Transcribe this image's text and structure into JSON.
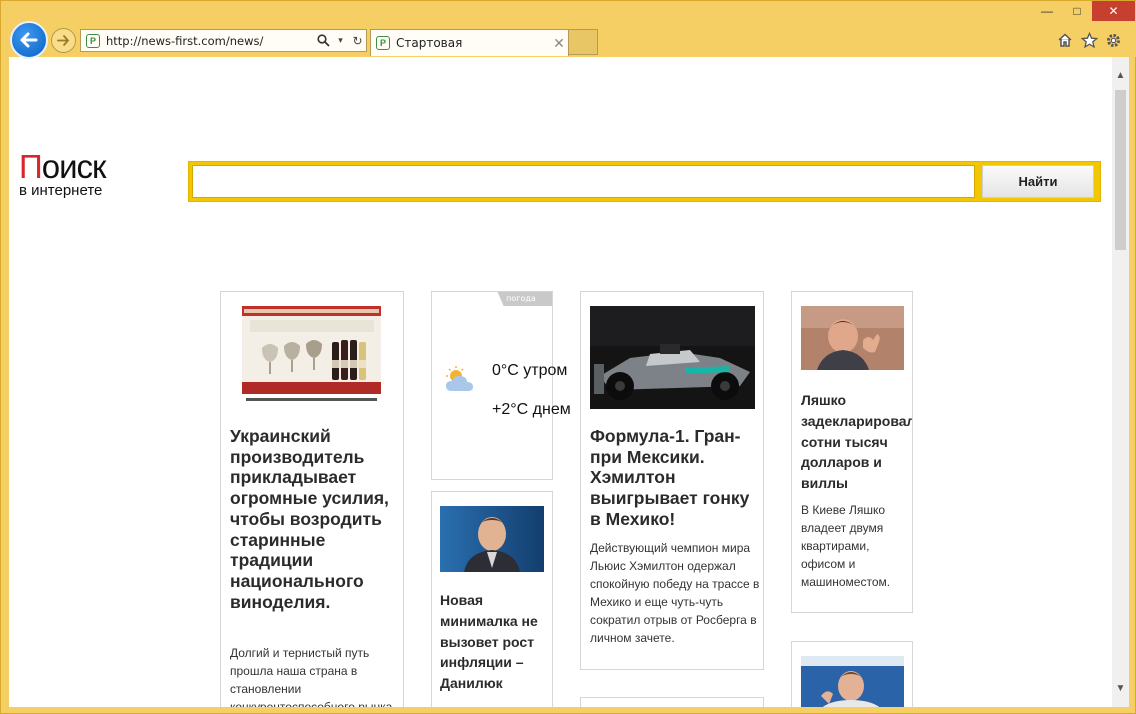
{
  "browser": {
    "url": "http://news-first.com/news/",
    "tab_title": "Стартовая",
    "site_icon_letter": "P"
  },
  "logo": {
    "first_letter": "П",
    "main_rest": "оиск",
    "sub": "в интернете"
  },
  "search": {
    "button_label": "Найти",
    "placeholder": ""
  },
  "cards": {
    "wine": {
      "title": "Украинский производитель прикладывает огромные усилия, чтобы возродить старинные традиции национального виноделия.",
      "text": "Долгий и тернистый путь прошла наша страна в становлении конкурентоспособного рынка"
    },
    "weather": {
      "tag": "погода",
      "morning": "0°C утром",
      "day": "+2°C днем"
    },
    "danilyuk": {
      "title": "Новая минималка не вызовет рост инфляции – Данилюк"
    },
    "f1": {
      "title": "Формула-1. Гран-при Мексики. Хэмилтон выигрывает гонку в Мехико!",
      "text": "Действующий чемпион мира Льюис Хэмилтон одержал спокойную победу на трассе в Мехико и еще чуть-чуть сократил отрыв от Росберга в личном зачете."
    },
    "lyashko": {
      "title": "Ляшко задекларировал сотни тысяч долларов и виллы",
      "text": "В Киеве Ляшко владеет двумя квартирами, офисом и машиноместом."
    }
  }
}
